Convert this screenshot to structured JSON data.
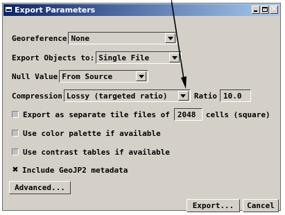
{
  "window": {
    "title": "Export Parameters"
  },
  "georeference": {
    "label": "Georeference",
    "value": "None"
  },
  "export_objects": {
    "label": "Export Objects to:",
    "value": "Single File"
  },
  "null_value": {
    "label": "Null Value",
    "value": "From Source"
  },
  "compression": {
    "label": "Compression",
    "value": "Lossy (targeted ratio)",
    "ratio_label": "Ratio",
    "ratio_value": "10.0"
  },
  "tiles": {
    "label_before": "Export as separate tile files of",
    "size": "2048",
    "label_after": "cells (square)",
    "checked": false
  },
  "color_palette": {
    "label": "Use color palette if available",
    "checked": false
  },
  "contrast_tables": {
    "label": "Use contrast tables if available",
    "checked": false
  },
  "geojp2": {
    "label": "Include GeoJP2 metadata",
    "checked": true,
    "mark": "✖"
  },
  "buttons": {
    "advanced": "Advanced...",
    "export": "Export...",
    "cancel": "Cancel"
  },
  "titlebar_buttons": {
    "close": "✕"
  }
}
